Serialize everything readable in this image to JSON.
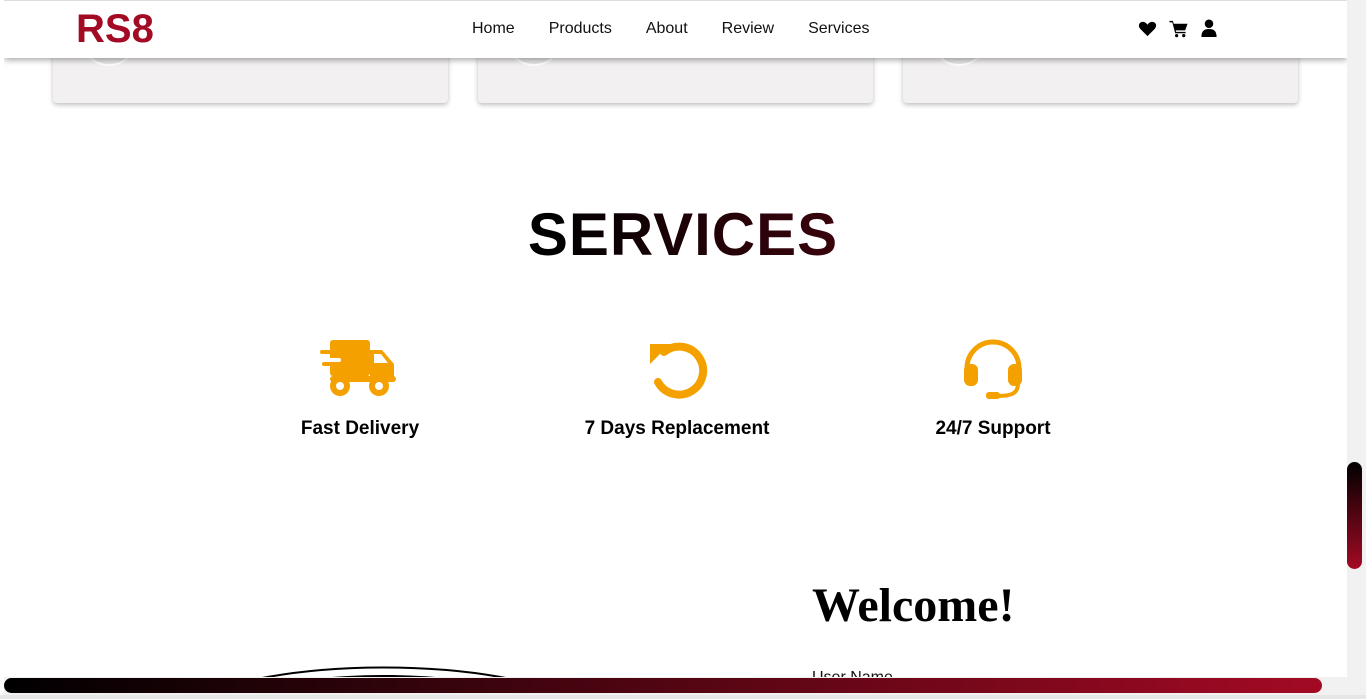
{
  "header": {
    "logo": "RS8",
    "nav": [
      "Home",
      "Products",
      "About",
      "Review",
      "Services"
    ],
    "icons": [
      "heart-icon",
      "cart-icon",
      "user-icon"
    ]
  },
  "services": {
    "title": "SERVICES",
    "items": [
      {
        "label": "Fast Delivery",
        "icon": "truck-icon"
      },
      {
        "label": "7 Days Replacement",
        "icon": "undo-icon"
      },
      {
        "label": "24/7 Support",
        "icon": "headset-icon"
      }
    ]
  },
  "login": {
    "title": "Welcome!",
    "username_label": "User Name"
  },
  "colors": {
    "brand": "#a30a24",
    "icon": "#f4a100",
    "text": "#000000"
  }
}
